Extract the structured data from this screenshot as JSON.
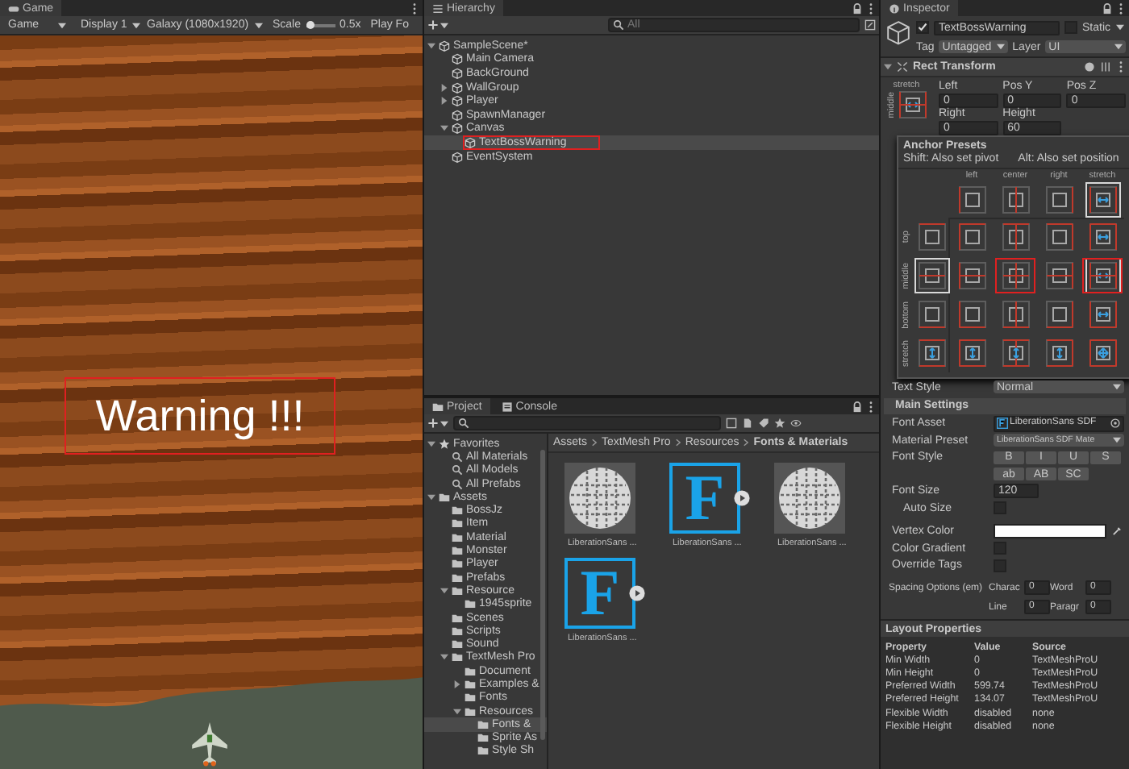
{
  "game": {
    "tab": "Game",
    "toolbar": {
      "view": "Game",
      "display": "Display 1",
      "resolution": "Galaxy (1080x1920)",
      "scale": {
        "label": "Scale",
        "level": 0.1,
        "value": "0.5x"
      },
      "play_mode": "Play Fo"
    },
    "warning_text": "Warning !!!"
  },
  "hierarchy": {
    "tab": "Hierarchy",
    "search": {
      "placeholder": "All"
    },
    "tree": [
      {
        "kind": "scene",
        "label": "SampleScene*",
        "expanded": true,
        "selected": false,
        "outlined": false,
        "children": [
          {
            "kind": "object",
            "label": "Main Camera",
            "selected": false,
            "outlined": false
          },
          {
            "kind": "object",
            "label": "BackGround",
            "selected": false,
            "outlined": false
          },
          {
            "kind": "object",
            "label": "WallGroup",
            "expanded": false,
            "selected": false,
            "outlined": false
          },
          {
            "kind": "object",
            "label": "Player",
            "expanded": false,
            "selected": false,
            "outlined": false
          },
          {
            "kind": "object",
            "label": "SpawnManager",
            "selected": false,
            "outlined": false
          },
          {
            "kind": "object",
            "label": "Canvas",
            "expanded": true,
            "selected": false,
            "outlined": false,
            "children": [
              {
                "kind": "object",
                "label": "TextBossWarning",
                "selected": true,
                "outlined": true
              }
            ]
          },
          {
            "kind": "object",
            "label": "EventSystem",
            "selected": false,
            "outlined": false
          }
        ]
      }
    ]
  },
  "project": {
    "tabs": [
      {
        "label": "Project",
        "selected": true
      },
      {
        "label": "Console",
        "selected": false
      }
    ],
    "tree": [
      {
        "kind": "favorites",
        "label": "Favorites",
        "expanded": true,
        "selected": false,
        "children": [
          {
            "kind": "search",
            "label": "All Materials",
            "selected": false
          },
          {
            "kind": "search",
            "label": "All Models",
            "selected": false
          },
          {
            "kind": "search",
            "label": "All Prefabs",
            "selected": false
          }
        ]
      },
      {
        "kind": "folder",
        "label": "Assets",
        "expanded": true,
        "selected": false,
        "children": [
          {
            "kind": "folder",
            "label": "BossJz",
            "selected": false
          },
          {
            "kind": "folder",
            "label": "Item",
            "selected": false
          },
          {
            "kind": "folder",
            "label": "Material",
            "selected": false
          },
          {
            "kind": "folder",
            "label": "Monster",
            "selected": false
          },
          {
            "kind": "folder",
            "label": "Player",
            "selected": false
          },
          {
            "kind": "folder",
            "label": "Prefabs",
            "selected": false
          },
          {
            "kind": "folder",
            "label": "Resource",
            "expanded": true,
            "selected": false,
            "children": [
              {
                "kind": "folder",
                "label": "1945sprite",
                "selected": false
              }
            ]
          },
          {
            "kind": "folder",
            "label": "Scenes",
            "selected": false
          },
          {
            "kind": "folder",
            "label": "Scripts",
            "selected": false
          },
          {
            "kind": "folder",
            "label": "Sound",
            "selected": false
          },
          {
            "kind": "folder",
            "label": "TextMesh Pro",
            "expanded": true,
            "selected": false,
            "children": [
              {
                "kind": "folder",
                "label": "Document",
                "selected": false
              },
              {
                "kind": "folder",
                "label": "Examples &",
                "expanded": false,
                "selected": false
              },
              {
                "kind": "folder",
                "label": "Fonts",
                "selected": false
              },
              {
                "kind": "folder",
                "label": "Resources",
                "expanded": true,
                "selected": false,
                "children": [
                  {
                    "kind": "folder",
                    "label": "Fonts &",
                    "selected": true
                  },
                  {
                    "kind": "folder",
                    "label": "Sprite As",
                    "selected": false
                  },
                  {
                    "kind": "folder",
                    "label": "Style Sh",
                    "selected": false
                  }
                ]
              }
            ]
          }
        ]
      }
    ],
    "breadcrumb": [
      "Assets",
      "TextMesh Pro",
      "Resources",
      "Fonts & Materials"
    ],
    "assets": [
      {
        "kind": "texture",
        "label": "LiberationSans ..."
      },
      {
        "kind": "font",
        "glyph": "F",
        "label": "LiberationSans ..."
      },
      {
        "kind": "texture",
        "label": "LiberationSans ..."
      },
      {
        "kind": "font",
        "glyph": "F",
        "label": "LiberationSans ..."
      }
    ]
  },
  "inspector": {
    "tab": "Inspector",
    "object": {
      "active": true,
      "name": "TextBossWarning",
      "static_label": "Static",
      "static": false
    },
    "tag": {
      "label": "Tag",
      "value": "Untagged"
    },
    "layer": {
      "label": "Layer",
      "value": "UI"
    },
    "rect_transform": {
      "title": "Rect Transform",
      "anchor_h": "stretch",
      "anchor_v": "middle",
      "fields": [
        {
          "label": "Left",
          "value": "0"
        },
        {
          "label": "Pos Y",
          "value": "0"
        },
        {
          "label": "Pos Z",
          "value": "0"
        },
        {
          "label": "Right",
          "value": "0"
        },
        {
          "label": "Height",
          "value": "60"
        }
      ]
    },
    "anchor_presets": {
      "title": "Anchor Presets",
      "hint_shift": "Shift: Also set pivot",
      "hint_alt": "Alt: Also set position",
      "columns": [
        {
          "label": "left",
          "selected": false
        },
        {
          "label": "center",
          "selected": false
        },
        {
          "label": "right",
          "selected": false
        },
        {
          "label": "stretch",
          "selected": true
        }
      ],
      "rows": [
        {
          "label": "top",
          "selected": false
        },
        {
          "label": "middle",
          "selected": true
        },
        {
          "label": "bottom",
          "selected": false
        },
        {
          "label": "stretch",
          "selected": false
        }
      ],
      "cells": [
        [
          {
            "selected": false,
            "outlined": false
          },
          {
            "selected": false,
            "outlined": false
          },
          {
            "selected": false,
            "outlined": false
          },
          {
            "selected": false,
            "outlined": false
          }
        ],
        [
          {
            "selected": false,
            "outlined": false
          },
          {
            "selected": false,
            "outlined": true
          },
          {
            "selected": false,
            "outlined": false
          },
          {
            "selected": true,
            "outlined": true
          }
        ],
        [
          {
            "selected": false,
            "outlined": false
          },
          {
            "selected": false,
            "outlined": false
          },
          {
            "selected": false,
            "outlined": false
          },
          {
            "selected": false,
            "outlined": false
          }
        ],
        [
          {
            "selected": false,
            "outlined": false
          },
          {
            "selected": false,
            "outlined": false
          },
          {
            "selected": false,
            "outlined": false
          },
          {
            "selected": false,
            "outlined": false
          }
        ]
      ]
    },
    "text_style": {
      "label": "Text Style",
      "value": "Normal"
    },
    "main_settings": {
      "title": "Main Settings",
      "font_asset": {
        "label": "Font Asset",
        "value": "LiberationSans SDF"
      },
      "material_preset": {
        "label": "Material Preset",
        "value": "LiberationSans SDF Mate"
      },
      "font_style": {
        "label": "Font Style",
        "buttons": [
          {
            "label": "B",
            "selected": false
          },
          {
            "label": "I",
            "selected": false
          },
          {
            "label": "U",
            "selected": false
          },
          {
            "label": "S",
            "selected": false
          },
          {
            "label": "ab",
            "selected": false
          },
          {
            "label": "AB",
            "selected": false
          },
          {
            "label": "SC",
            "selected": false
          }
        ]
      },
      "font_size": {
        "label": "Font Size",
        "value": "120"
      },
      "auto_size": {
        "label": "Auto Size",
        "checked": false
      },
      "vertex_color": {
        "label": "Vertex Color",
        "color": "#ffffff"
      },
      "color_gradient": {
        "label": "Color Gradient",
        "checked": false
      },
      "override_tags": {
        "label": "Override Tags",
        "checked": false
      },
      "spacing": {
        "label": "Spacing Options (em)",
        "fields": [
          {
            "label": "Charac",
            "value": "0"
          },
          {
            "label": "Word",
            "value": "0"
          },
          {
            "label": "Line",
            "value": "0"
          },
          {
            "label": "Paragr",
            "value": "0"
          }
        ]
      }
    },
    "layout_properties": {
      "title": "Layout Properties",
      "columns": [
        "Property",
        "Value",
        "Source"
      ],
      "rows": [
        [
          "Min Width",
          "0",
          "TextMeshProU"
        ],
        [
          "Min Height",
          "0",
          "TextMeshProU"
        ],
        [
          "Preferred Width",
          "599.74",
          "TextMeshProU"
        ],
        [
          "Preferred Height",
          "134.07",
          "TextMeshProU"
        ],
        [
          "Flexible Width",
          "disabled",
          "none"
        ],
        [
          "Flexible Height",
          "disabled",
          "none"
        ]
      ]
    }
  }
}
